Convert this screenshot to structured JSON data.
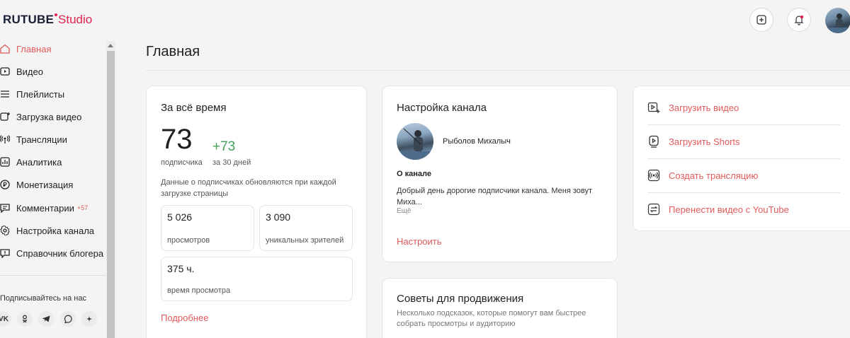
{
  "header": {
    "logo_main": "RUTUBE",
    "logo_studio": "Studio",
    "add_icon": "plus-square-icon",
    "bell_icon": "bell-icon",
    "notification_color": "#e0224e"
  },
  "sidebar": {
    "items": [
      {
        "label": "Главная",
        "icon": "home-icon"
      },
      {
        "label": "Видео",
        "icon": "video-icon"
      },
      {
        "label": "Плейлисты",
        "icon": "list-icon"
      },
      {
        "label": "Загрузка видео",
        "icon": "upload-icon"
      },
      {
        "label": "Трансляции",
        "icon": "broadcast-icon"
      },
      {
        "label": "Аналитика",
        "icon": "analytics-icon"
      },
      {
        "label": "Монетизация",
        "icon": "monetization-icon"
      },
      {
        "label": "Комментарии",
        "icon": "comments-icon",
        "badge": "+57"
      },
      {
        "label": "Настройка канала",
        "icon": "gear-icon"
      },
      {
        "label": "Справочник блогера",
        "icon": "help-icon"
      }
    ],
    "follow_label": "Подписывайтесь на нас",
    "social": [
      {
        "label": "VK",
        "icon": "vk-icon"
      },
      {
        "label": "OK",
        "icon": "ok-icon"
      },
      {
        "label": "TG",
        "icon": "telegram-icon"
      },
      {
        "label": "Viber",
        "icon": "viber-icon"
      },
      {
        "label": "Dzen",
        "icon": "dzen-icon"
      }
    ]
  },
  "main": {
    "title": "Главная",
    "stats_card": {
      "title": "За всё время",
      "subscribers": "73",
      "subscribers_label": "подписчика",
      "delta": "+73",
      "delta_label": "за 30 дней",
      "note": "Данные о подписчиках обновляются при каждой загрузке страницы",
      "views_value": "5 026",
      "views_label": "просмотров",
      "unique_value": "3 090",
      "unique_label": "уникальных зрителей",
      "watch_value": "375 ч.",
      "watch_label": "время просмотра",
      "more_link": "Подробнее"
    },
    "channel_card": {
      "title": "Настройка канала",
      "channel_name": "Рыболов Михалыч",
      "about_heading": "О канале",
      "about_text": "Добрый день дорогие подписчики канала. Меня зовут Миха...",
      "more": "Ещё",
      "setup_link": "Настроить"
    },
    "actions": [
      {
        "label": "Загрузить видео",
        "icon": "upload-video-icon"
      },
      {
        "label": "Загрузить Shorts",
        "icon": "shorts-icon"
      },
      {
        "label": "Создать трансляцию",
        "icon": "broadcast-icon"
      },
      {
        "label": "Перенести видео с YouTube",
        "icon": "transfer-icon"
      }
    ],
    "tips_card": {
      "title": "Советы для продвижения",
      "subtitle": "Несколько подсказок, которые помогут вам быстрее собрать просмотры и аудиторию"
    }
  },
  "colors": {
    "accent": "#e25a5a",
    "brand": "#e0224e",
    "positive": "#3fa35c"
  }
}
